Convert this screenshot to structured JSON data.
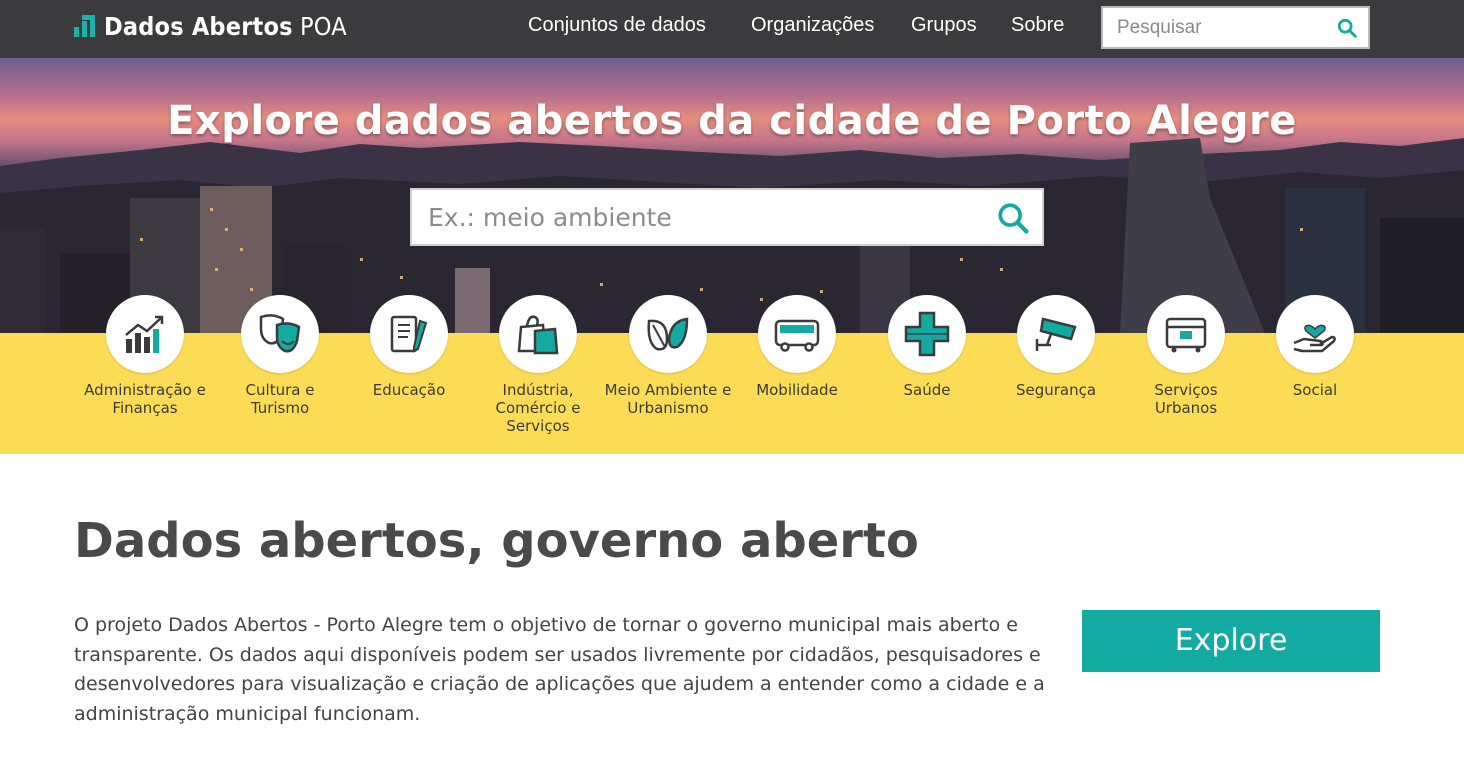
{
  "header": {
    "logo_bold": "Dados Abertos",
    "logo_light": "POA",
    "nav": [
      {
        "label": "Conjuntos de dados"
      },
      {
        "label": "Organizações"
      },
      {
        "label": "Grupos"
      },
      {
        "label": "Sobre"
      }
    ],
    "search_placeholder": "Pesquisar"
  },
  "hero": {
    "title": "Explore dados abertos da cidade de Porto Alegre",
    "search_placeholder": "Ex.: meio ambiente"
  },
  "categories": [
    {
      "label": "Administração e Finanças",
      "icon": "chart-growth-icon"
    },
    {
      "label": "Cultura e Turismo",
      "icon": "theater-masks-icon"
    },
    {
      "label": "Educação",
      "icon": "notebook-pencil-icon"
    },
    {
      "label": "Indústria, Comércio e Serviços",
      "icon": "shopping-bag-icon"
    },
    {
      "label": "Meio Ambiente e Urbanismo",
      "icon": "leaf-icon"
    },
    {
      "label": "Mobilidade",
      "icon": "bus-icon"
    },
    {
      "label": "Saúde",
      "icon": "health-cross-icon"
    },
    {
      "label": "Segurança",
      "icon": "security-camera-icon"
    },
    {
      "label": "Serviços Urbanos",
      "icon": "dumpster-icon"
    },
    {
      "label": "Social",
      "icon": "hand-heart-icon"
    }
  ],
  "main": {
    "title": "Dados abertos, governo aberto",
    "intro": "O projeto Dados Abertos - Porto Alegre tem o objetivo de tornar o governo municipal mais aberto e transparente. Os dados aqui disponíveis podem ser usados livremente por cidadãos, pesquisadores e desenvolvedores para visualização e criação de aplicações que ajudem a entender como a cidade e a administração municipal funcionam.",
    "explore_label": "Explore"
  },
  "colors": {
    "accent": "#13aaa2",
    "header_bg": "#3b3b3e",
    "band_yellow": "#fddc55"
  }
}
